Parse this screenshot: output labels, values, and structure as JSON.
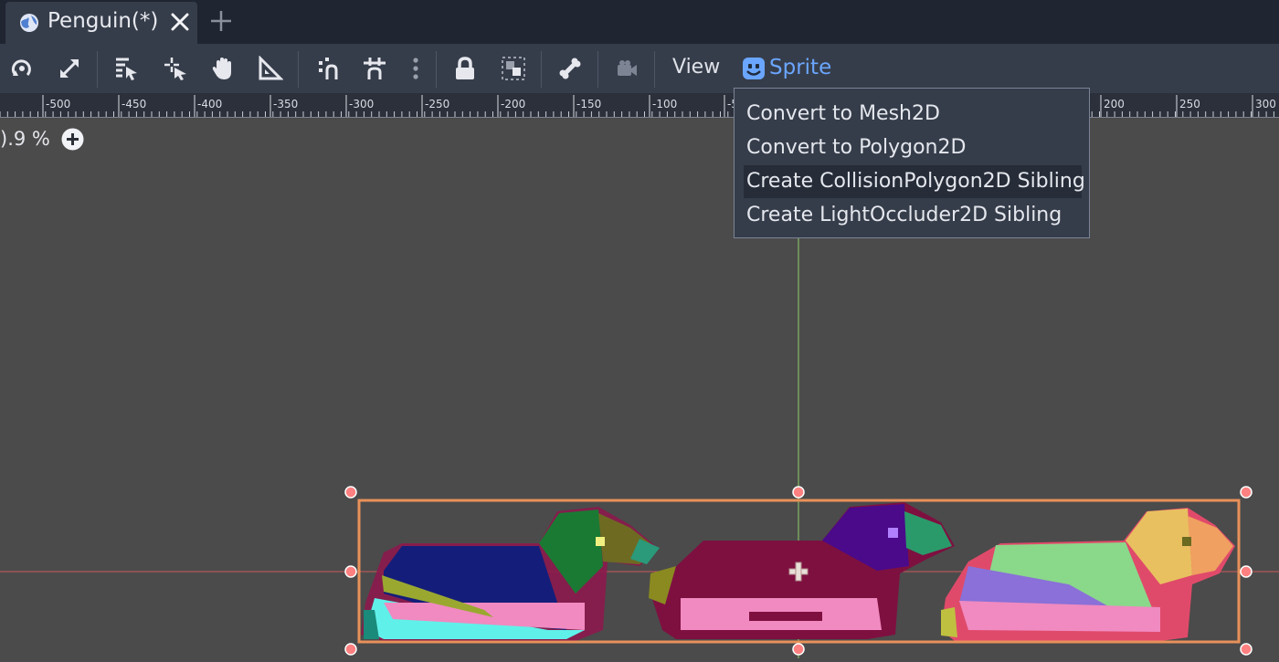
{
  "tab": {
    "title": "Penguin(*)",
    "icon": "scene-globe-icon",
    "close_icon": "close-icon",
    "add_icon": "plus-icon"
  },
  "toolbar": {
    "icons": [
      "rotate-icon",
      "scale-icon",
      "select-list-icon",
      "pivot-icon",
      "pan-hand-icon",
      "ruler-icon",
      "smart-snap-icon",
      "grid-snap-icon",
      "more-vertical-icon",
      "lock-icon",
      "group-icon",
      "bone-icon",
      "camera-override-icon"
    ],
    "view_label": "View",
    "sprite_label": "Sprite"
  },
  "ruler": {
    "labels": [
      "-500",
      "-450",
      "-400",
      "-350",
      "-300",
      "-250",
      "-200",
      "-150",
      "-100",
      "-5",
      "200",
      "250",
      "300"
    ]
  },
  "zoom": {
    "value": ").9 %"
  },
  "sprite_menu": {
    "items": [
      "Convert to Mesh2D",
      "Convert to Polygon2D",
      "Create CollisionPolygon2D Sibling",
      "Create LightOccluder2D Sibling"
    ],
    "hovered_index": 2
  },
  "colors": {
    "accent_blue": "#6aa6ff",
    "selection_orange": "#e8915a",
    "handle_red": "#ff7777",
    "axis_green": "#8fcc6a",
    "axis_red": "#d06060"
  }
}
